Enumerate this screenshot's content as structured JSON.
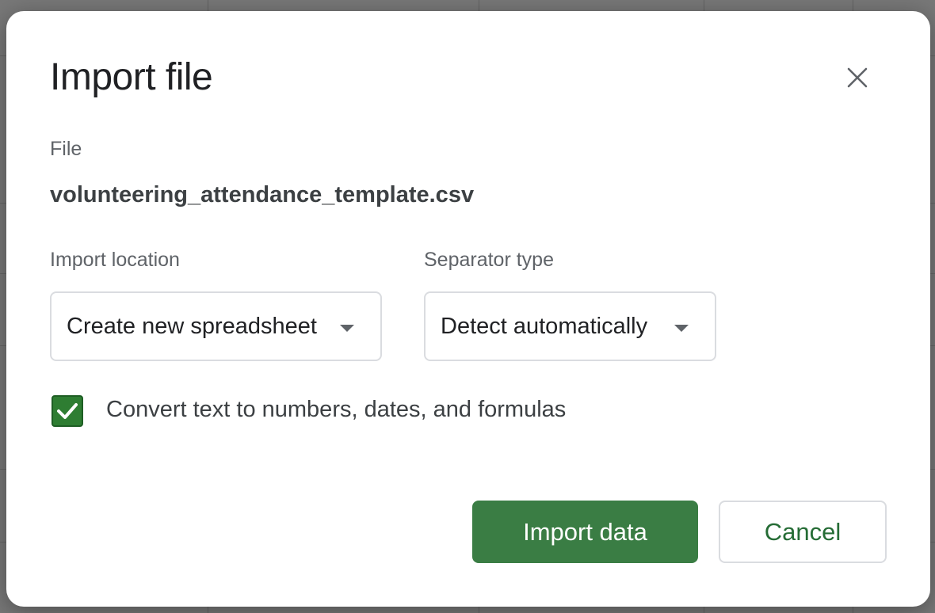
{
  "dialog": {
    "title": "Import file",
    "close_icon": "close-icon",
    "file": {
      "label": "File",
      "name": "volunteering_attendance_template.csv"
    },
    "import_location": {
      "label": "Import location",
      "selected": "Create new spreadsheet"
    },
    "separator_type": {
      "label": "Separator type",
      "selected": "Detect automatically"
    },
    "convert_option": {
      "label": "Convert text to numbers, dates, and formulas",
      "checked": true
    },
    "buttons": {
      "import": "Import data",
      "cancel": "Cancel"
    }
  },
  "colors": {
    "primary_button": "#3a7d44",
    "checkbox": "#2e7d32",
    "cancel_text": "#256c35",
    "title_text": "#202124"
  }
}
